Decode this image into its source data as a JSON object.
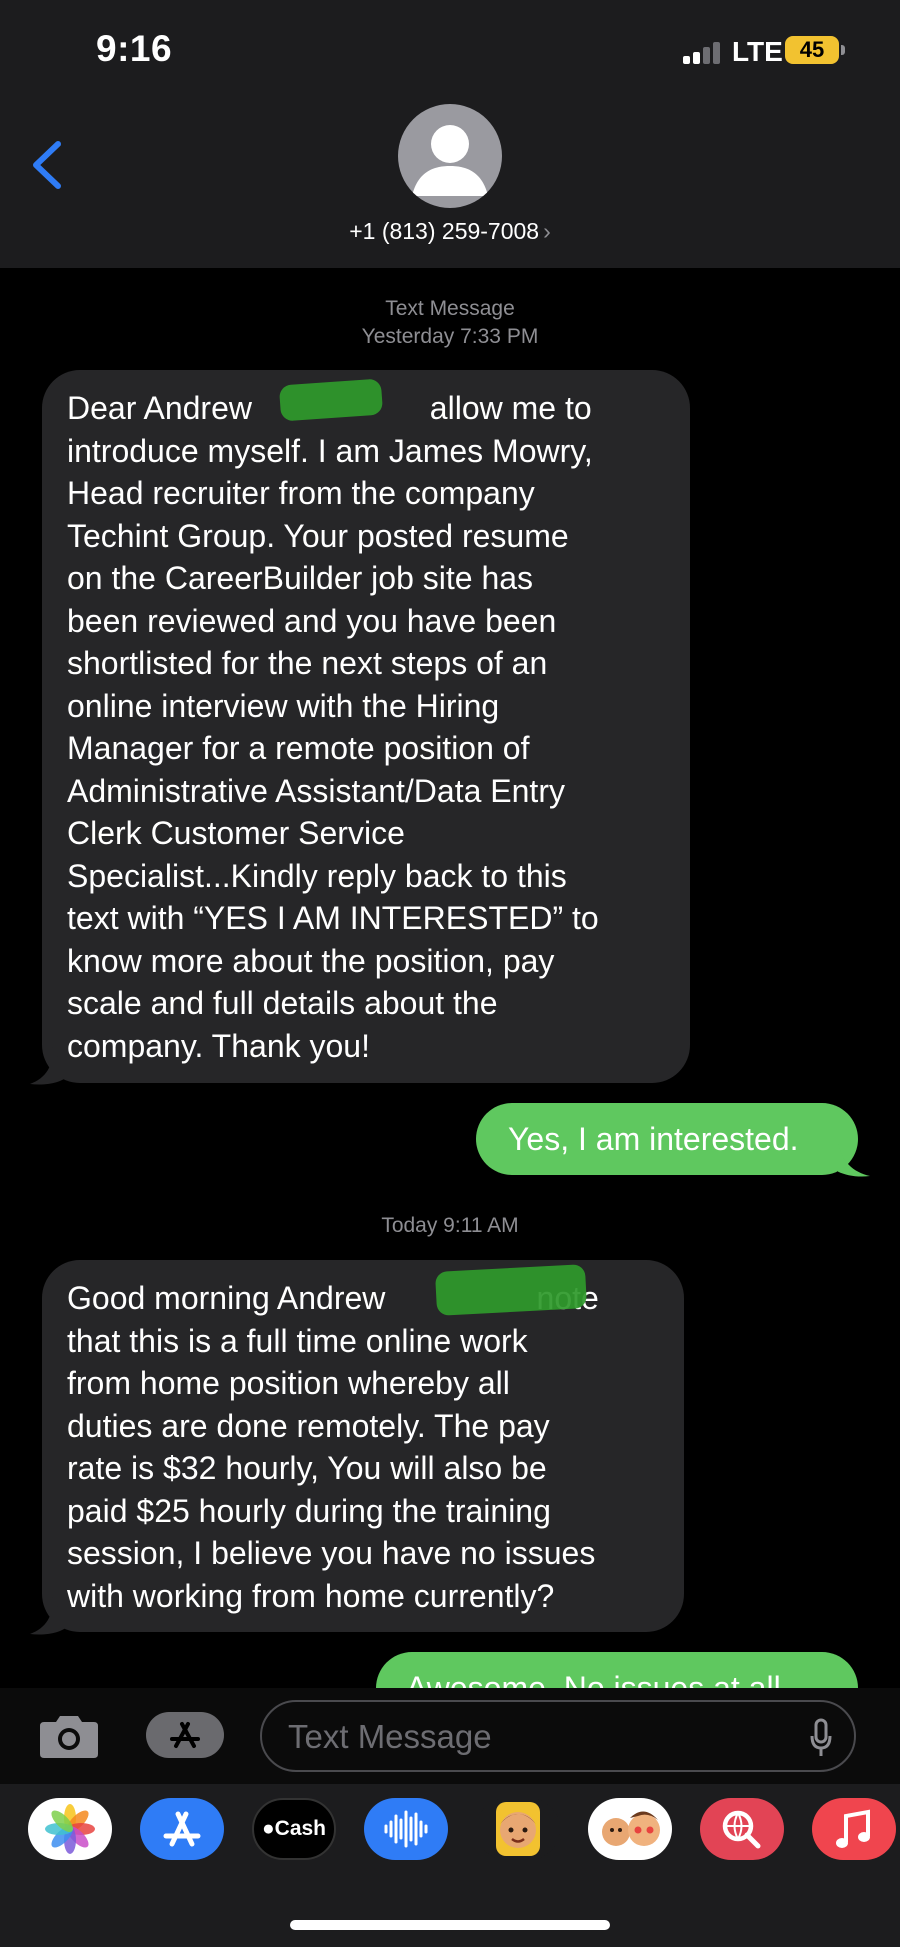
{
  "status_bar": {
    "time": "9:16",
    "carrier": "LTE",
    "battery": "45"
  },
  "header": {
    "contact": "+1 (813) 259-7008",
    "chevron": "›",
    "back_icon": "chevron-left-icon",
    "avatar_icon": "person-icon"
  },
  "thread": {
    "timestamp_1_line1": "Text Message",
    "timestamp_1_line2": "Yesterday 7:33 PM",
    "msg1_lines": [
      "Dear Andrew                    allow me to",
      "introduce myself. I am James Mowry,",
      "Head recruiter from the company",
      "Techint Group. Your posted resume",
      "on the CareerBuilder job site has",
      "been reviewed and you have been",
      "shortlisted for the next steps of an",
      "online interview with the Hiring",
      "Manager for a remote position of",
      "Administrative Assistant/Data Entry",
      "Clerk Customer Service",
      "Specialist...Kindly reply back to this",
      "text with “YES I AM INTERESTED” to",
      "know more about the position, pay",
      "scale and full details about the",
      "company. Thank you!"
    ],
    "reply1": "Yes, I am interested.",
    "timestamp_2": "Today 9:11 AM",
    "msg2_lines": [
      "Good morning Andrew                 note",
      "that this is a full time online work",
      "from home position whereby all",
      "duties are done remotely. The pay",
      "rate is $32 hourly, You will also be",
      "paid $25 hourly during the training",
      "session, I believe you have no issues",
      "with working from home currently?"
    ],
    "reply2_partial": "Awesome. No issues at all."
  },
  "composer": {
    "placeholder": "Text Message",
    "camera_icon": "camera-icon",
    "apps_icon": "app-store-icon",
    "mic_icon": "microphone-icon"
  },
  "drawer": {
    "apps": [
      {
        "name": "Photos",
        "icon": "photos-icon"
      },
      {
        "name": "App Store",
        "icon": "app-store-icon"
      },
      {
        "label": "Cash",
        "icon": "apple-cash-icon"
      },
      {
        "name": "Audio Messages",
        "icon": "waveform-icon"
      },
      {
        "name": "Memoji",
        "icon": "memoji-icon"
      },
      {
        "name": "Memoji Stickers",
        "icon": "memoji-stickers-icon"
      },
      {
        "name": "Search Images",
        "icon": "image-search-icon"
      },
      {
        "name": "Music",
        "icon": "music-icon"
      }
    ]
  },
  "colors": {
    "header_bg": "#1c1c1e",
    "incoming_bubble": "#262628",
    "outgoing_bubble": "#5fc85f",
    "accent_blue": "#2f7cf6",
    "redaction": "#2f9a2c"
  }
}
